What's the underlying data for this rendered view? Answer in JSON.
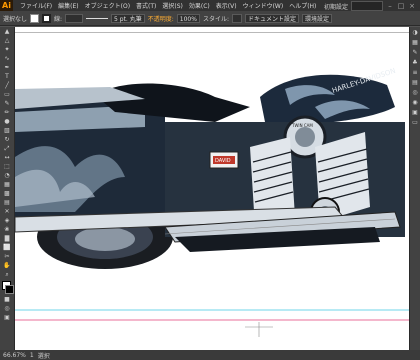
{
  "menubar": {
    "logo": "Ai",
    "items": [
      "ファイル(F)",
      "編集(E)",
      "オブジェクト(O)",
      "書式(T)",
      "選択(S)",
      "効果(C)",
      "表示(V)",
      "ウィンドウ(W)",
      "ヘルプ(H)"
    ],
    "workspace": "初期設定",
    "window_controls": [
      "–",
      "□",
      "×"
    ]
  },
  "controlbar": {
    "selection_label": "選択なし",
    "stroke_label": "線:",
    "stroke_weight": "5 pt. 丸筆",
    "opacity_label": "不透明度:",
    "opacity_value": "100%",
    "style_label": "スタイル:",
    "doc_setup_button": "ドキュメント設定",
    "prefs_button": "環境設定"
  },
  "colors": {
    "ui_dark": "#535353",
    "panel": "#424242",
    "menubar": "#323232",
    "ai_orange": "#ff9a00",
    "bike_navy": "#1f2c3d",
    "bike_steel": "#8a9aaa",
    "bike_light": "#cfd6dd",
    "tank_badge_red": "#c0392b"
  },
  "canvas": {
    "tank_logo": "HARLEY-DAVIDSON",
    "engine_cover_text": "TWIN CAM",
    "badge_text": "DAVID"
  },
  "statusbar": {
    "zoom": "66.67%",
    "page": "1",
    "tool_name": "選択"
  }
}
